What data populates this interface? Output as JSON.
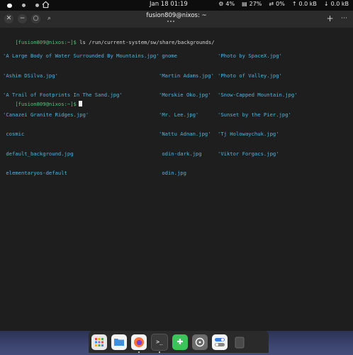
{
  "topbar": {
    "workspace_dots": 3,
    "clock": "Jan 18  01:19",
    "tray": [
      {
        "icon": "cpu-icon",
        "label": "4%"
      },
      {
        "icon": "memory-icon",
        "label": "27%"
      },
      {
        "icon": "swap-icon",
        "label": "0%"
      },
      {
        "icon": "upload-icon",
        "label": "0.0 kB"
      },
      {
        "icon": "download-icon",
        "label": "0.0 kB"
      }
    ]
  },
  "header": {
    "title": "fusion809@nixos: ~",
    "close_label": "✕",
    "minimize_label": "−",
    "maximize_label": "○",
    "search_label": "⌕",
    "new_tab_label": "+",
    "menu_label": "⋯"
  },
  "terminal": {
    "prompt": "[fusion809@nixos:~]$",
    "command": " ls /run/current-system/sw/share/backgrounds/",
    "columns": [
      [
        "'A Large Body of Water Surrounded By Mountains.jpg'",
        "'Ashim DSilva.jpg'",
        "'A Trail of Footprints In The Sand.jpg'",
        "'Canazei Granite Ridges.jpg'",
        " cosmic",
        " default_background.jpg",
        " elementaryos-default"
      ],
      [
        " gnome",
        "'Martin Adams.jpg'",
        "'Morskie Oko.jpg'",
        "'Mr. Lee.jpg'",
        "'Nattu Adnan.jpg'",
        " odin-dark.jpg",
        " odin.jpg"
      ],
      [
        "'Photo by SpaceX.jpg'",
        "'Photo of Valley.jpg'",
        "'Snow-Capped Mountain.jpg'",
        "'Sunset by the Pier.jpg'",
        "'Tj Holowaychuk.jpg'",
        "'Viktor Forgacs.jpg'"
      ]
    ],
    "prompt2": "[fusion809@nixos:~]$"
  },
  "dock": {
    "apps": [
      {
        "name": "app-grid",
        "label": "▦",
        "color": "#e8e8e8"
      },
      {
        "name": "files",
        "label": "▬",
        "color": "#3d8fe0"
      },
      {
        "name": "firefox",
        "label": "◉",
        "color": "#ff7139"
      },
      {
        "name": "terminal",
        "label": ">_",
        "color": "#3a3a3a"
      },
      {
        "name": "extensions",
        "label": "✚",
        "color": "#3bc45a"
      },
      {
        "name": "steering",
        "label": "⊛",
        "color": "#6b6b6b"
      },
      {
        "name": "settings-toggle",
        "label": "⊙",
        "color": "#3a7de0"
      },
      {
        "name": "trash",
        "label": "▮",
        "color": "#555555"
      }
    ]
  }
}
